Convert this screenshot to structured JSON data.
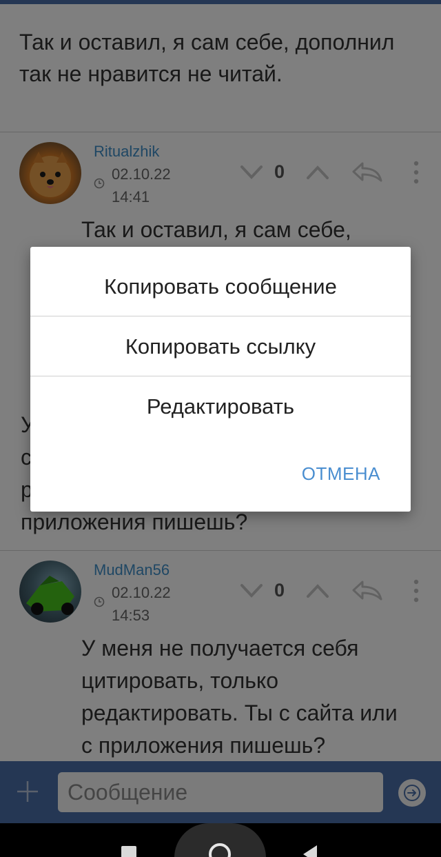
{
  "previous_message": {
    "text": "Так и оставил, я сам себе, дополнил так не нравится не читай."
  },
  "comments": [
    {
      "author": "Ritualzhik",
      "date": "02.10.22",
      "time": "14:41",
      "score": "0",
      "text": "Так и оставил, я сам себе,",
      "avatar": "pomeranian-dog-avatar",
      "partial_lines": [
        "У",
        "с",
        "р",
        "приложения пишешь?"
      ]
    },
    {
      "author": "MudMan56",
      "date": "02.10.22",
      "time": "14:53",
      "score": "0",
      "text": "У меня не получается себя цитировать, только редактировать. Ты с сайта или с приложения пишешь?",
      "avatar": "motorcycle-avatar"
    }
  ],
  "context_menu": {
    "items": [
      "Копировать сообщение",
      "Копировать ссылку",
      "Редактировать"
    ],
    "cancel": "ОТМЕНА"
  },
  "composer": {
    "placeholder": "Сообщение"
  },
  "colors": {
    "accent": "#4a6ea8",
    "author": "#3f8fc8",
    "cancel": "#4a8ed0",
    "dim": "rgba(0,0,0,0.5)"
  }
}
